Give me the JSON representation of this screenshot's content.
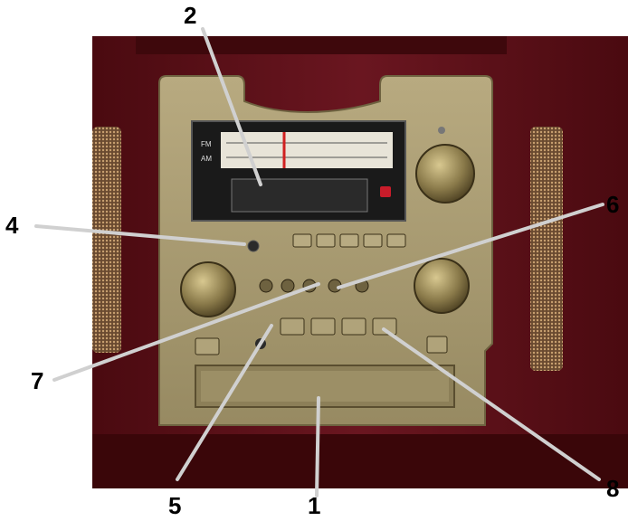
{
  "callouts": {
    "c1": "1",
    "c2": "2",
    "c4": "4",
    "c5": "5",
    "c6": "6",
    "c7": "7",
    "c8": "8"
  },
  "colors": {
    "cabinet": "#5a0e14",
    "faceplate": "#a89a72",
    "display": "#1a1a1a",
    "pointer_line": "#d0d0d0"
  }
}
